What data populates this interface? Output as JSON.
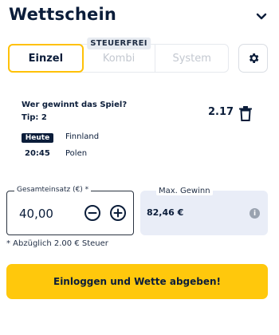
{
  "header": {
    "title": "Wettschein",
    "collapse_icon": "chevron-down-icon"
  },
  "tabs": {
    "items": [
      {
        "label": "Einzel",
        "active": true
      },
      {
        "label": "Kombi",
        "active": false,
        "badge": "STEUERFREI"
      },
      {
        "label": "System",
        "active": false
      }
    ],
    "settings_icon": "gear-icon"
  },
  "bet": {
    "question": "Wer gewinnt das Spiel?",
    "tip": "Tip: 2",
    "odds": "2.17",
    "delete_icon": "trash-icon",
    "day_badge": "Heute",
    "time": "20:45",
    "team_home": "Finnland",
    "team_away": "Polen"
  },
  "stake": {
    "label": "Gesamteinsatz (€) *",
    "value": "40,00",
    "minus_icon": "minus-circle-icon",
    "plus_icon": "plus-circle-icon"
  },
  "max_win": {
    "label": "Max. Gewinn",
    "value": "82,46 €",
    "info_icon": "info-icon"
  },
  "note": "* Abzüglich 2.00 € Steuer",
  "submit_label": "Einloggen und Wette abgeben!",
  "colors": {
    "accent": "#ffc80c",
    "primary_text": "#0b1d3a",
    "win_box_bg": "#e9edf7"
  }
}
